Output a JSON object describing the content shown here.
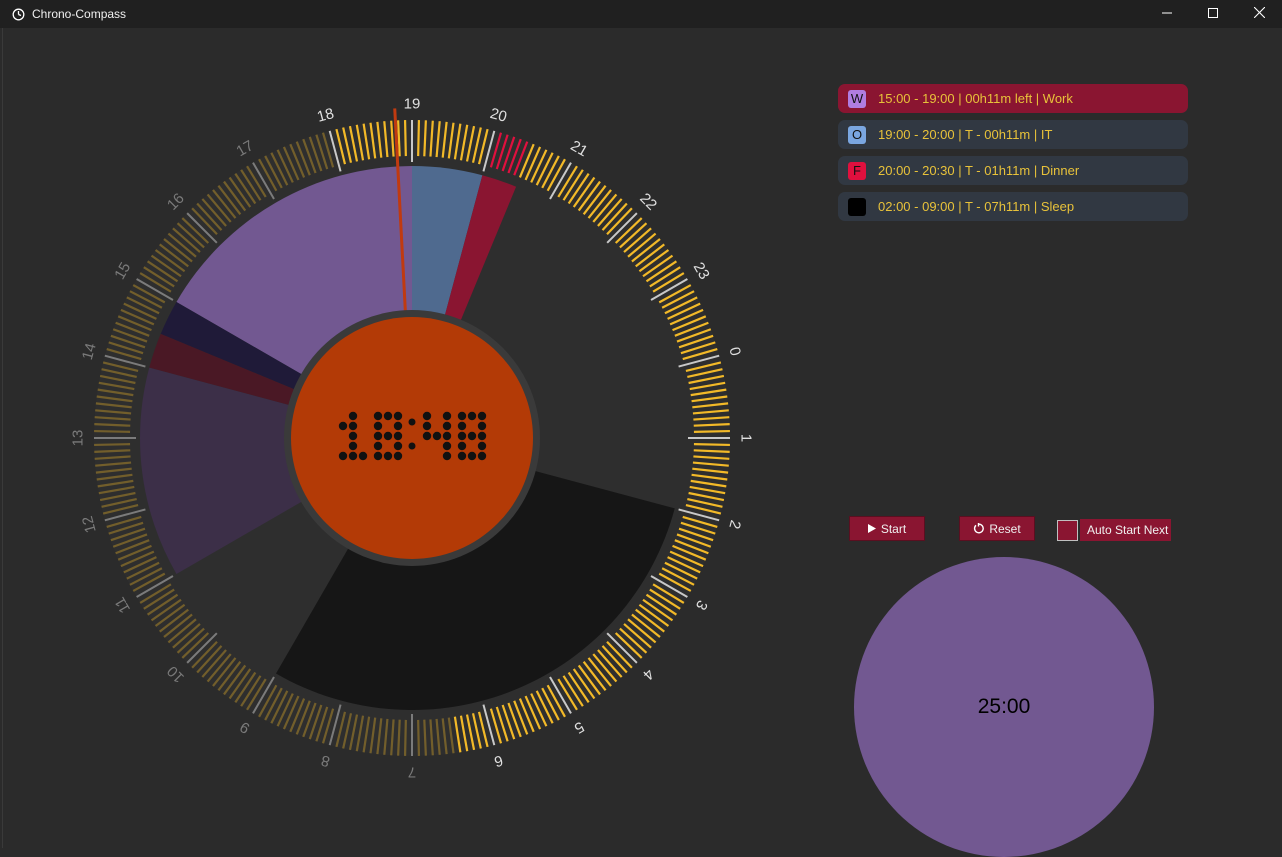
{
  "window": {
    "title": "Chrono-Compass",
    "controls": [
      "minimize-icon",
      "maximize-icon",
      "close-icon"
    ]
  },
  "clock": {
    "time": "18:48",
    "center_color": "#b33a06"
  },
  "dial": {
    "hour_labels": [
      "0",
      "1",
      "2",
      "3",
      "4",
      "5",
      "6",
      "7",
      "8",
      "9",
      "10",
      "11",
      "12",
      "13",
      "14",
      "15",
      "16",
      "17",
      "18",
      "19",
      "20",
      "21",
      "22",
      "23"
    ],
    "tick_color": "#f2b928",
    "segments": [
      {
        "name": "Work",
        "start": 15.0,
        "end": 19.0,
        "color": "#725891"
      },
      {
        "name": "IT",
        "start": 19.0,
        "end": 20.0,
        "color": "#4f6a8f"
      },
      {
        "name": "Dinner",
        "start": 20.0,
        "end": 20.5,
        "color": "#8a1531"
      },
      {
        "name": "Sleep",
        "start": 2.0,
        "end": 9.0,
        "color": "#161616"
      },
      {
        "name": "past-1",
        "start": 14.5,
        "end": 15.0,
        "color": "#1f1a38"
      },
      {
        "name": "past-2",
        "start": 14.0,
        "end": 14.5,
        "color": "#4a1825"
      },
      {
        "name": "past-3",
        "start": 11.0,
        "end": 14.0,
        "color": "#3c2f48"
      }
    ]
  },
  "schedule": [
    {
      "badge": "W",
      "badge_color": "#b07de0",
      "text": "15:00 - 19:00  |  00h11m left  |  Work",
      "active": true
    },
    {
      "badge": "O",
      "badge_color": "#7aa6e0",
      "text": "19:00 - 20:00  |  T - 00h11m  |  IT",
      "active": false
    },
    {
      "badge": "F",
      "badge_color": "#e0103e",
      "text": "20:00 - 20:30  |  T - 01h11m  |  Dinner",
      "active": false
    },
    {
      "badge": "",
      "badge_color": "#000000",
      "text": "02:00 - 09:00  |  T - 07h11m  |  Sleep",
      "active": false
    }
  ],
  "controls": {
    "start_label": "Start",
    "reset_label": "Reset",
    "auto_start_label": "Auto Start Next"
  },
  "pomodoro": {
    "time": "25:00",
    "color": "#725891"
  }
}
